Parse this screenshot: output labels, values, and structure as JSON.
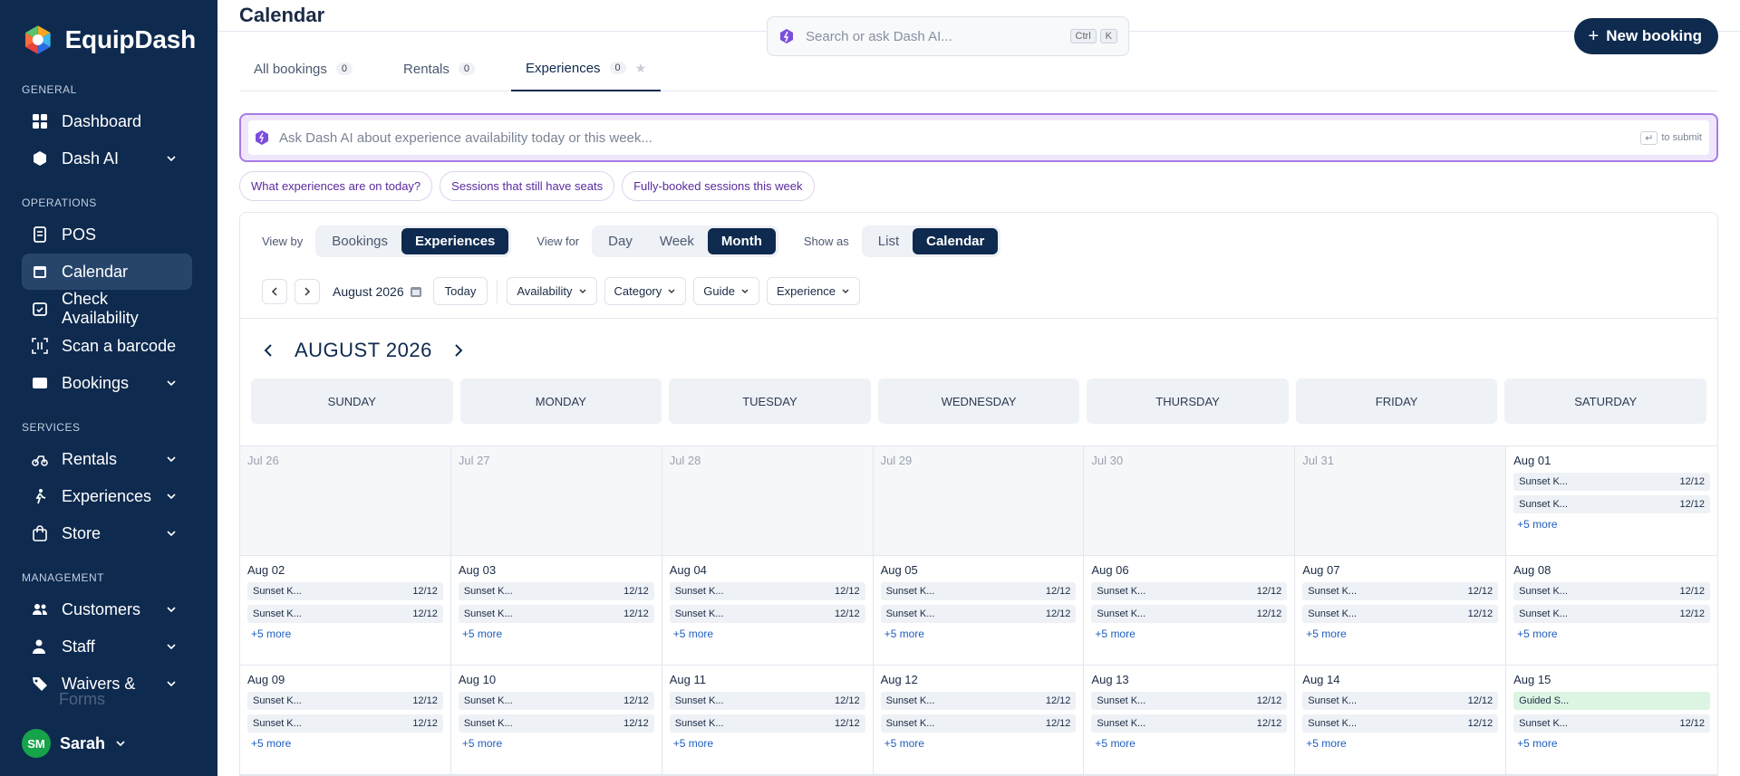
{
  "app": {
    "name": "EquipDash"
  },
  "sidebar": {
    "sections": {
      "general": "GENERAL",
      "operations": "OPERATIONS",
      "services": "SERVICES",
      "management": "MANAGEMENT"
    },
    "items": {
      "dashboard": "Dashboard",
      "dash_ai": "Dash AI",
      "pos": "POS",
      "calendar": "Calendar",
      "check_availability": "Check Availability",
      "scan_barcode": "Scan a barcode",
      "bookings": "Bookings",
      "rentals": "Rentals",
      "experiences": "Experiences",
      "store": "Store",
      "customers": "Customers",
      "staff": "Staff",
      "waivers": "Waivers &",
      "waivers_cont": "Forms"
    },
    "user": {
      "initials": "SM",
      "name": "Sarah"
    }
  },
  "header": {
    "title": "Calendar",
    "search_placeholder": "Search or ask Dash AI...",
    "kbd_ctrl": "Ctrl",
    "kbd_k": "K",
    "new_booking": "New booking"
  },
  "tabs": [
    {
      "label": "All bookings",
      "count": "0"
    },
    {
      "label": "Rentals",
      "count": "0"
    },
    {
      "label": "Experiences",
      "count": "0"
    }
  ],
  "ai": {
    "placeholder": "Ask Dash AI about experience availability today or this week...",
    "enter_key": "↵",
    "submit_hint": "to submit",
    "chips": [
      "What experiences are on today?",
      "Sessions that still have seats",
      "Fully-booked sessions this week"
    ]
  },
  "controls": {
    "view_by_label": "View by",
    "view_by": [
      "Bookings",
      "Experiences"
    ],
    "view_for_label": "View for",
    "view_for": [
      "Day",
      "Week",
      "Month"
    ],
    "show_as_label": "Show as",
    "show_as": [
      "List",
      "Calendar"
    ],
    "month_label": "August 2026",
    "today": "Today",
    "filters": [
      "Availability",
      "Category",
      "Guide",
      "Experience"
    ]
  },
  "calendar": {
    "title": "AUGUST 2026",
    "weekdays": [
      "SUNDAY",
      "MONDAY",
      "TUESDAY",
      "WEDNESDAY",
      "THURSDAY",
      "FRIDAY",
      "SATURDAY"
    ],
    "more_label": "+5 more",
    "cells": [
      {
        "day": "Jul 26",
        "muted": true,
        "events": []
      },
      {
        "day": "Jul 27",
        "muted": true,
        "events": []
      },
      {
        "day": "Jul 28",
        "muted": true,
        "events": []
      },
      {
        "day": "Jul 29",
        "muted": true,
        "events": []
      },
      {
        "day": "Jul 30",
        "muted": true,
        "events": []
      },
      {
        "day": "Jul 31",
        "muted": true,
        "events": []
      },
      {
        "day": "Aug 01",
        "events": [
          {
            "name": "Sunset K...",
            "seats": "12/12"
          },
          {
            "name": "Sunset K...",
            "seats": "12/12"
          }
        ],
        "more": true
      },
      {
        "day": "Aug 02",
        "events": [
          {
            "name": "Sunset K...",
            "seats": "12/12"
          },
          {
            "name": "Sunset K...",
            "seats": "12/12"
          }
        ],
        "more": true
      },
      {
        "day": "Aug 03",
        "events": [
          {
            "name": "Sunset K...",
            "seats": "12/12"
          },
          {
            "name": "Sunset K...",
            "seats": "12/12"
          }
        ],
        "more": true
      },
      {
        "day": "Aug 04",
        "events": [
          {
            "name": "Sunset K...",
            "seats": "12/12"
          },
          {
            "name": "Sunset K...",
            "seats": "12/12"
          }
        ],
        "more": true
      },
      {
        "day": "Aug 05",
        "events": [
          {
            "name": "Sunset K...",
            "seats": "12/12"
          },
          {
            "name": "Sunset K...",
            "seats": "12/12"
          }
        ],
        "more": true
      },
      {
        "day": "Aug 06",
        "events": [
          {
            "name": "Sunset K...",
            "seats": "12/12"
          },
          {
            "name": "Sunset K...",
            "seats": "12/12"
          }
        ],
        "more": true
      },
      {
        "day": "Aug 07",
        "events": [
          {
            "name": "Sunset K...",
            "seats": "12/12"
          },
          {
            "name": "Sunset K...",
            "seats": "12/12"
          }
        ],
        "more": true
      },
      {
        "day": "Aug 08",
        "events": [
          {
            "name": "Sunset K...",
            "seats": "12/12"
          },
          {
            "name": "Sunset K...",
            "seats": "12/12"
          }
        ],
        "more": true
      },
      {
        "day": "Aug 09",
        "events": [
          {
            "name": "Sunset K...",
            "seats": "12/12"
          },
          {
            "name": "Sunset K...",
            "seats": "12/12"
          }
        ],
        "more": true
      },
      {
        "day": "Aug 10",
        "events": [
          {
            "name": "Sunset K...",
            "seats": "12/12"
          },
          {
            "name": "Sunset K...",
            "seats": "12/12"
          }
        ],
        "more": true
      },
      {
        "day": "Aug 11",
        "events": [
          {
            "name": "Sunset K...",
            "seats": "12/12"
          },
          {
            "name": "Sunset K...",
            "seats": "12/12"
          }
        ],
        "more": true
      },
      {
        "day": "Aug 12",
        "events": [
          {
            "name": "Sunset K...",
            "seats": "12/12"
          },
          {
            "name": "Sunset K...",
            "seats": "12/12"
          }
        ],
        "more": true
      },
      {
        "day": "Aug 13",
        "events": [
          {
            "name": "Sunset K...",
            "seats": "12/12"
          },
          {
            "name": "Sunset K...",
            "seats": "12/12"
          }
        ],
        "more": true
      },
      {
        "day": "Aug 14",
        "events": [
          {
            "name": "Sunset K...",
            "seats": "12/12"
          },
          {
            "name": "Sunset K...",
            "seats": "12/12"
          }
        ],
        "more": true
      },
      {
        "day": "Aug 15",
        "events": [
          {
            "name": "Guided S...",
            "seats": "",
            "green": true
          },
          {
            "name": "Sunset K...",
            "seats": "12/12"
          }
        ],
        "more": true
      }
    ]
  },
  "colors": {
    "sidebar": "#0e2a4f",
    "accent": "#0e2a4f",
    "ai_border": "#a77be6",
    "link": "#1f5fbf",
    "avatar": "#16a34a"
  }
}
